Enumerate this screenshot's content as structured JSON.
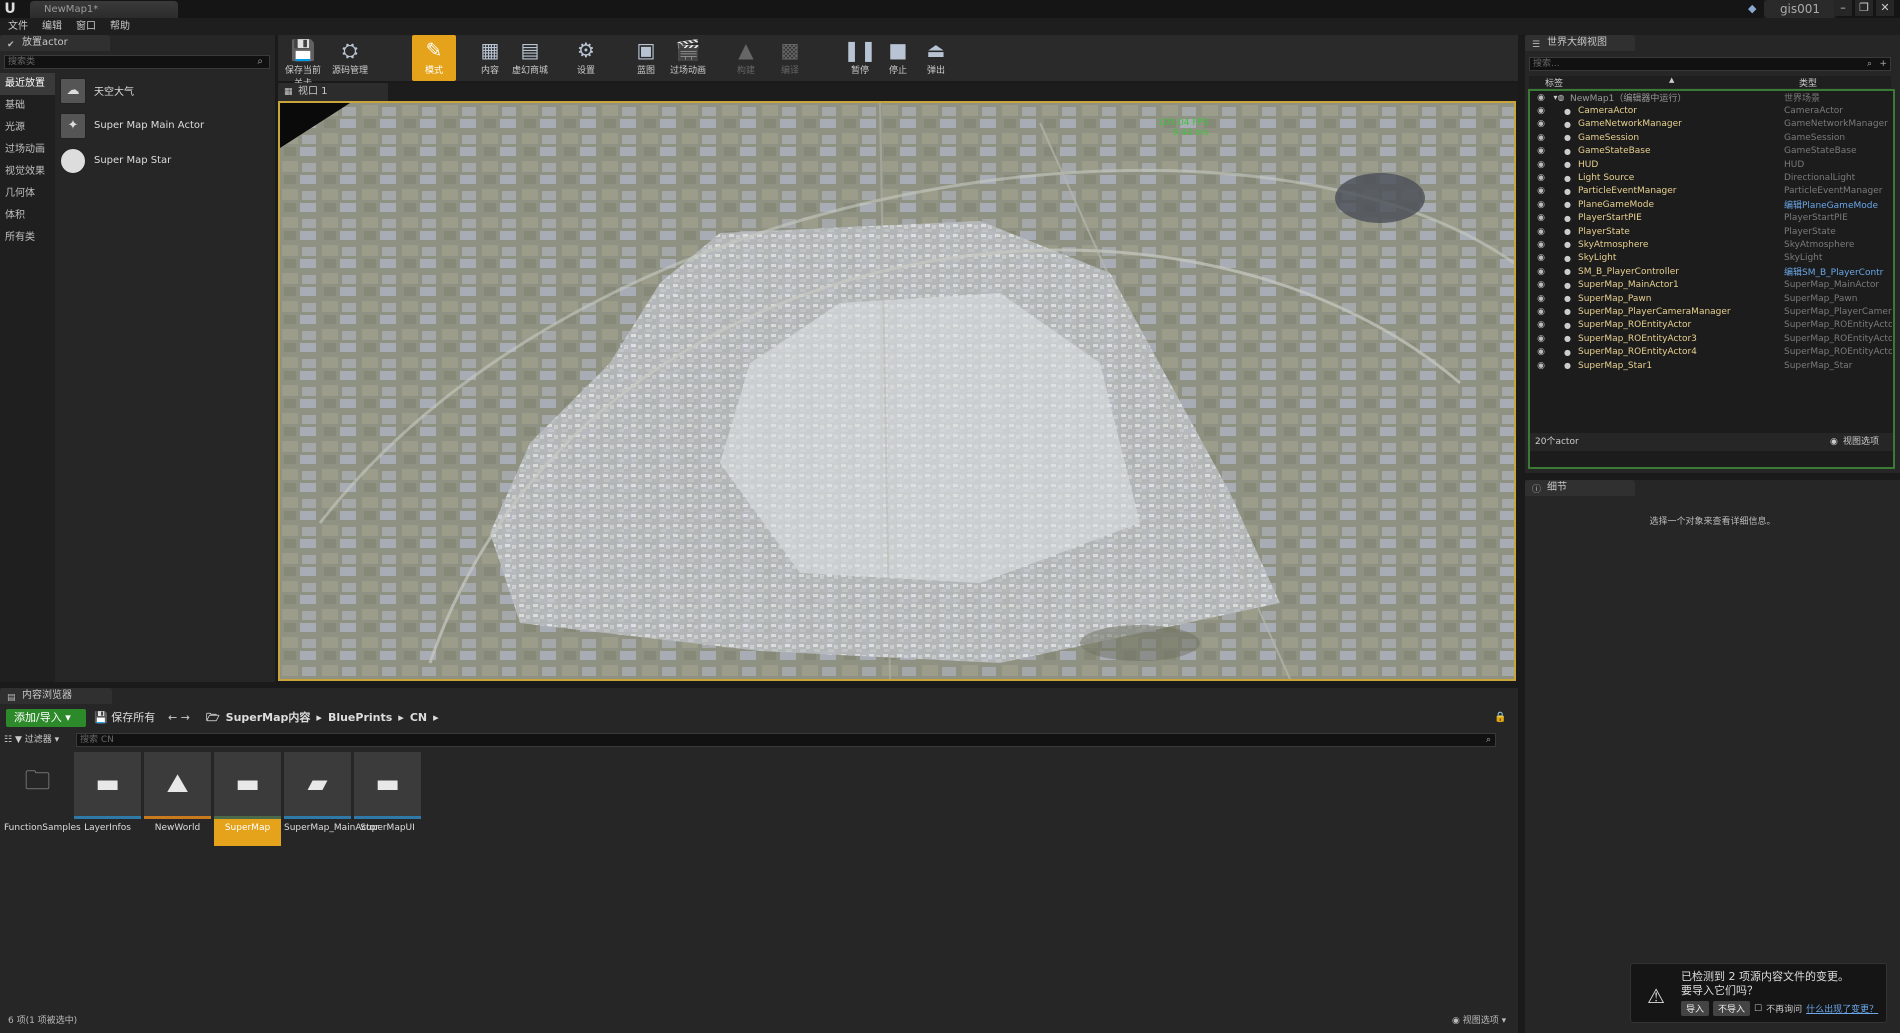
{
  "titlebar": {
    "tab": "NewMap1*",
    "user": "gis001"
  },
  "menu": [
    "文件",
    "编辑",
    "窗口",
    "帮助"
  ],
  "place_actor": {
    "tab": "放置actor",
    "search_placeholder": "搜索类",
    "categories": [
      "最近放置",
      "基础",
      "光源",
      "过场动画",
      "视觉效果",
      "几何体",
      "体积",
      "所有类"
    ],
    "items": [
      "天空大气",
      "Super Map Main Actor",
      "Super Map Star"
    ]
  },
  "toolbar": [
    {
      "label": "保存当前关卡",
      "icon": "save-icon"
    },
    {
      "label": "源码管理",
      "icon": "source-control-icon"
    },
    {
      "label": "模式",
      "icon": "modes-icon"
    },
    {
      "label": "内容",
      "icon": "content-icon"
    },
    {
      "label": "虚幻商城",
      "icon": "marketplace-icon"
    },
    {
      "label": "设置",
      "icon": "settings-icon"
    },
    {
      "label": "蓝图",
      "icon": "blueprint-icon"
    },
    {
      "label": "过场动画",
      "icon": "cinematics-icon"
    },
    {
      "label": "构建",
      "icon": "build-icon"
    },
    {
      "label": "编译",
      "icon": "compile-icon"
    },
    {
      "label": "暂停",
      "icon": "pause-icon"
    },
    {
      "label": "停止",
      "icon": "stop-icon"
    },
    {
      "label": "弹出",
      "icon": "eject-icon"
    }
  ],
  "viewport": {
    "tab": "视口 1",
    "fps": "105.04 FPS",
    "ms": "9.44 ms"
  },
  "outliner": {
    "tab": "世界大纲视图",
    "search_placeholder": "搜索...",
    "col_label": "标签",
    "col_type": "类型",
    "rows": [
      {
        "label": "NewMap1（编辑器中运行）",
        "type": "世界场景",
        "root": true
      },
      {
        "label": "CameraActor",
        "type": "CameraActor"
      },
      {
        "label": "GameNetworkManager",
        "type": "GameNetworkManager"
      },
      {
        "label": "GameSession",
        "type": "GameSession"
      },
      {
        "label": "GameStateBase",
        "type": "GameStateBase"
      },
      {
        "label": "HUD",
        "type": "HUD"
      },
      {
        "label": "Light Source",
        "type": "DirectionalLight"
      },
      {
        "label": "ParticleEventManager",
        "type": "ParticleEventManager"
      },
      {
        "label": "PlaneGameMode",
        "type": "编辑PlaneGameMode",
        "link": true
      },
      {
        "label": "PlayerStartPIE",
        "type": "PlayerStartPIE"
      },
      {
        "label": "PlayerState",
        "type": "PlayerState"
      },
      {
        "label": "SkyAtmosphere",
        "type": "SkyAtmosphere"
      },
      {
        "label": "SkyLight",
        "type": "SkyLight"
      },
      {
        "label": "SM_B_PlayerController",
        "type": "编辑SM_B_PlayerContr",
        "link": true
      },
      {
        "label": "SuperMap_MainActor1",
        "type": "SuperMap_MainActor"
      },
      {
        "label": "SuperMap_Pawn",
        "type": "SuperMap_Pawn"
      },
      {
        "label": "SuperMap_PlayerCameraManager",
        "type": "SuperMap_PlayerCamera"
      },
      {
        "label": "SuperMap_ROEntityActor",
        "type": "SuperMap_ROEntityActor"
      },
      {
        "label": "SuperMap_ROEntityActor3",
        "type": "SuperMap_ROEntityActor"
      },
      {
        "label": "SuperMap_ROEntityActor4",
        "type": "SuperMap_ROEntityActor"
      },
      {
        "label": "SuperMap_Star1",
        "type": "SuperMap_Star"
      }
    ],
    "count": "20个actor",
    "view_options": "视图选项"
  },
  "details": {
    "tab": "细节",
    "message": "选择一个对象来查看详细信息。"
  },
  "content_browser": {
    "tab": "内容浏览器",
    "add_import": "添加/导入",
    "save_all": "保存所有",
    "breadcrumb": [
      "SuperMap内容",
      "BluePrints",
      "CN"
    ],
    "filters": "过滤器",
    "search_placeholder": "搜索 CN",
    "assets": [
      {
        "name": "FunctionSamples",
        "kind": "folder",
        "color": "#9a9a9a"
      },
      {
        "name": "LayerInfos",
        "kind": "blueprint",
        "color": "#2f79a8"
      },
      {
        "name": "NewWorld",
        "kind": "level",
        "color": "#c87a1c"
      },
      {
        "name": "SuperMap",
        "kind": "blueprint",
        "color": "#4a6a4a",
        "selected": true
      },
      {
        "name": "SuperMap_MainActor",
        "kind": "actor",
        "color": "#2f79a8"
      },
      {
        "name": "SuperMapUI",
        "kind": "blueprint",
        "color": "#2f79a8"
      }
    ],
    "status": "6 项(1 项被选中)",
    "view_options": "视图选项"
  },
  "notification": {
    "message_1": "已检测到 2 项源内容文件的变更。",
    "message_2": "要导入它们吗？",
    "import": "导入",
    "dont_import": "不导入",
    "dont_ask": "不再询问",
    "link": "什么出现了变更？"
  }
}
